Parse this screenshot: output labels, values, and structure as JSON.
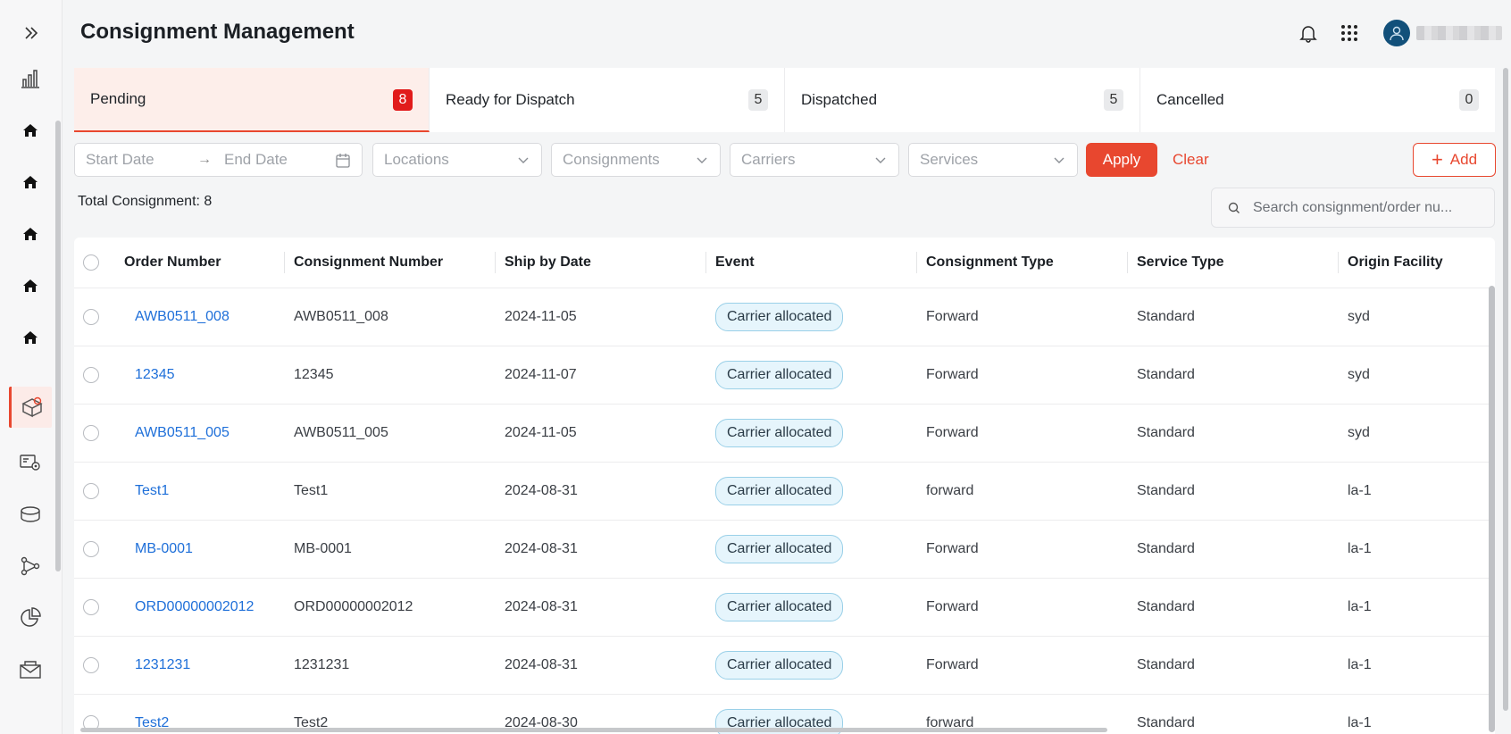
{
  "header": {
    "title": "Consignment Management",
    "icons": [
      "bell-icon",
      "apps-grid-icon",
      "user-avatar-icon"
    ]
  },
  "sidebar": {
    "items": [
      {
        "icon": "expand-chevrons-icon"
      },
      {
        "icon": "bar-chart-icon"
      },
      {
        "icon": "home-icon"
      },
      {
        "icon": "home-icon"
      },
      {
        "icon": "home-icon"
      },
      {
        "icon": "home-icon"
      },
      {
        "icon": "home-icon"
      },
      {
        "icon": "package-icon",
        "active": true
      },
      {
        "icon": "settings-card-icon"
      },
      {
        "icon": "database-icon"
      },
      {
        "icon": "network-icon"
      },
      {
        "icon": "pie-chart-icon"
      },
      {
        "icon": "envelope-icon"
      }
    ]
  },
  "tabs": [
    {
      "label": "Pending",
      "count": "8",
      "active": true
    },
    {
      "label": "Ready for Dispatch",
      "count": "5"
    },
    {
      "label": "Dispatched",
      "count": "5"
    },
    {
      "label": "Cancelled",
      "count": "0"
    }
  ],
  "filters": {
    "start_date_placeholder": "Start Date",
    "end_date_placeholder": "End Date",
    "arrow": "→",
    "locations": "Locations",
    "consignments": "Consignments",
    "carriers": "Carriers",
    "services": "Services",
    "apply": "Apply",
    "clear": "Clear",
    "add": "Add",
    "add_plus": "+"
  },
  "summary": {
    "total": "Total Consignment: 8"
  },
  "search": {
    "placeholder": "Search consignment/order nu..."
  },
  "table": {
    "columns": [
      "Order Number",
      "Consignment Number",
      "Ship by Date",
      "Event",
      "Consignment Type",
      "Service Type",
      "Origin Facility"
    ],
    "rows": [
      [
        "AWB0511_008",
        "AWB0511_008",
        "2024-11-05",
        "Carrier allocated",
        "Forward",
        "Standard",
        "syd"
      ],
      [
        "12345",
        "12345",
        "2024-11-07",
        "Carrier allocated",
        "Forward",
        "Standard",
        "syd"
      ],
      [
        "AWB0511_005",
        "AWB0511_005",
        "2024-11-05",
        "Carrier allocated",
        "Forward",
        "Standard",
        "syd"
      ],
      [
        "Test1",
        "Test1",
        "2024-08-31",
        "Carrier allocated",
        "forward",
        "Standard",
        "la-1"
      ],
      [
        "MB-0001",
        "MB-0001",
        "2024-08-31",
        "Carrier allocated",
        "Forward",
        "Standard",
        "la-1"
      ],
      [
        "ORD00000002012",
        "ORD00000002012",
        "2024-08-31",
        "Carrier allocated",
        "Forward",
        "Standard",
        "la-1"
      ],
      [
        "1231231",
        "1231231",
        "2024-08-31",
        "Carrier allocated",
        "Forward",
        "Standard",
        "la-1"
      ],
      [
        "Test2",
        "Test2",
        "2024-08-30",
        "Carrier allocated",
        "forward",
        "Standard",
        "la-1"
      ]
    ]
  },
  "colors": {
    "accent": "#e8472f",
    "link": "#1e6fd9",
    "pill_bg": "#e6f5fc",
    "pill_border": "#9ad0e8",
    "badge_active": "#e11b1b"
  }
}
